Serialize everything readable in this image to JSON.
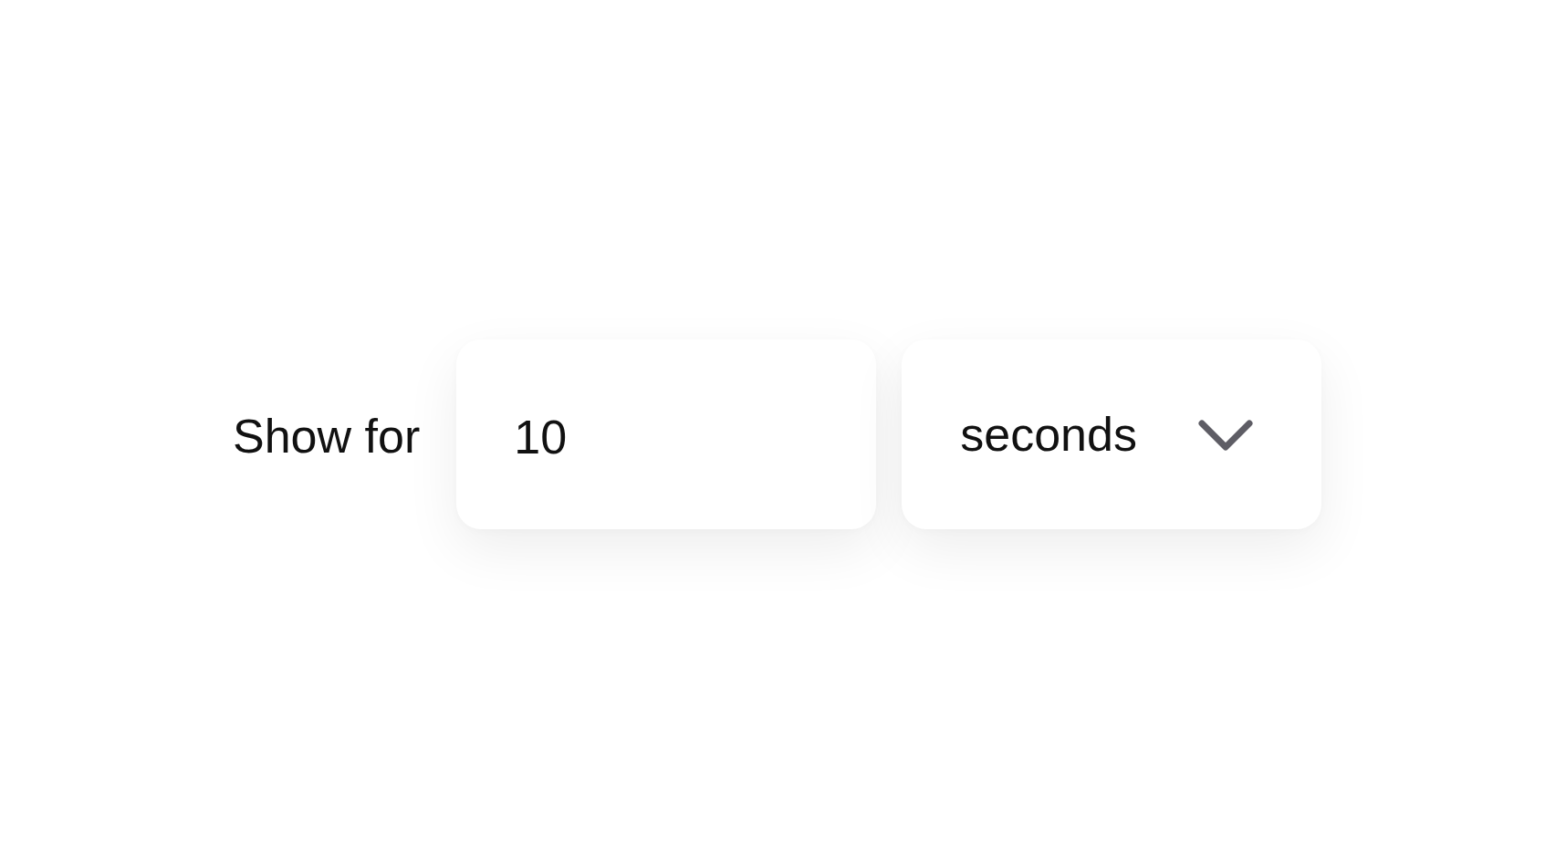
{
  "label": "Show for",
  "duration": {
    "value": "10"
  },
  "unit": {
    "value": "seconds"
  }
}
